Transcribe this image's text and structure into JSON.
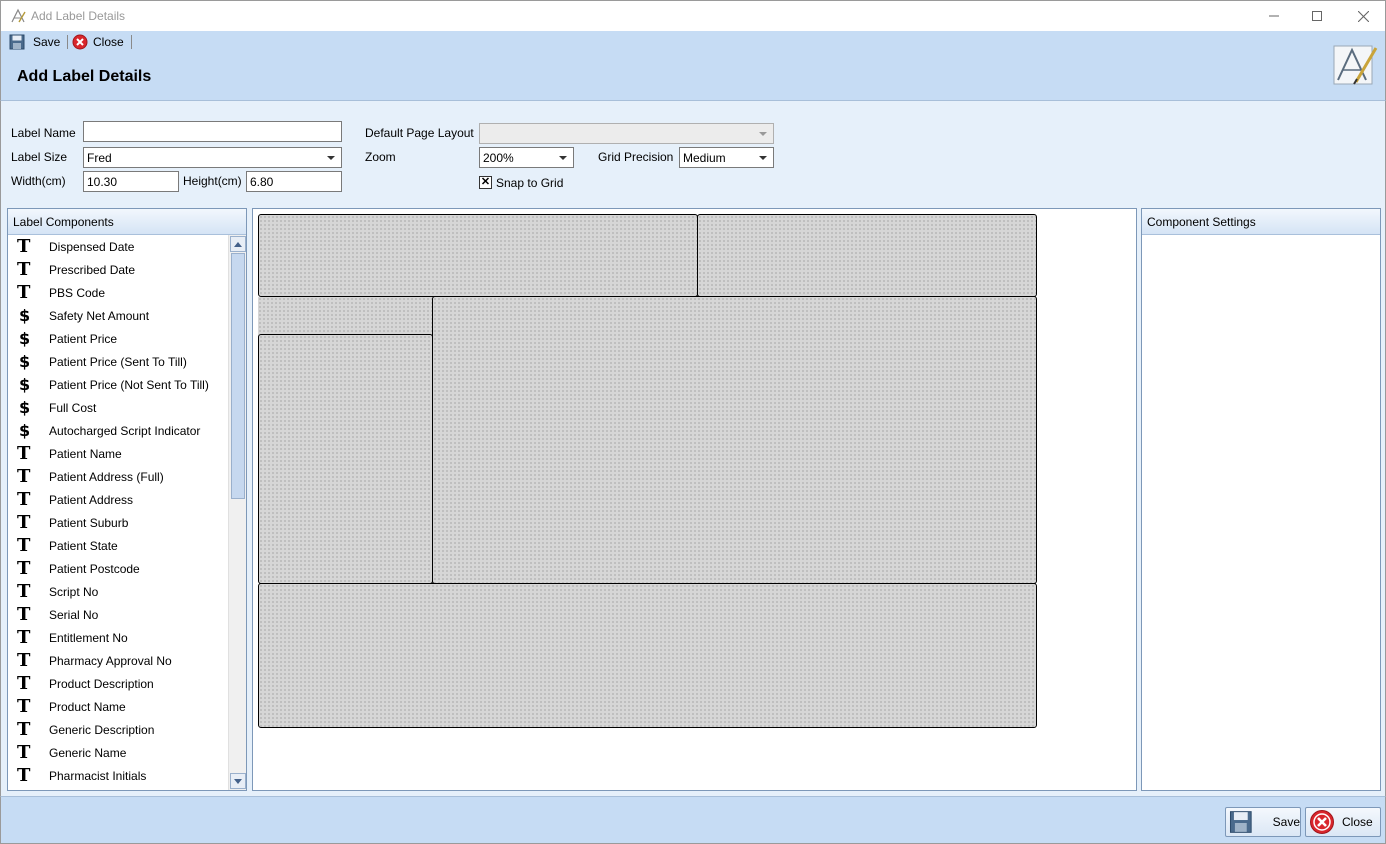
{
  "window": {
    "title": "Add Label Details"
  },
  "toolbar": {
    "save_label": "Save",
    "close_label": "Close"
  },
  "header": {
    "heading": "Add Label Details"
  },
  "form": {
    "label_name": {
      "label": "Label Name",
      "value": ""
    },
    "label_size": {
      "label": "Label Size",
      "value": "Fred"
    },
    "width": {
      "label": "Width(cm)",
      "value": "10.30"
    },
    "height": {
      "label": "Height(cm)",
      "value": "6.80"
    },
    "default_page_layout": {
      "label": "Default Page Layout",
      "value": ""
    },
    "zoom": {
      "label": "Zoom",
      "value": "200%"
    },
    "grid_precision": {
      "label": "Grid Precision",
      "value": "Medium"
    },
    "snap_to_grid": {
      "label": "Snap to Grid",
      "checked": true,
      "mark": "✕"
    }
  },
  "components_panel": {
    "title": "Label Components",
    "items": [
      {
        "icon": "text-icon",
        "glyph": "T",
        "label": "Dispensed Date"
      },
      {
        "icon": "text-icon",
        "glyph": "T",
        "label": "Prescribed Date"
      },
      {
        "icon": "text-icon",
        "glyph": "T",
        "label": "PBS Code"
      },
      {
        "icon": "dollar-icon",
        "glyph": "$",
        "label": "Safety Net Amount"
      },
      {
        "icon": "dollar-icon",
        "glyph": "$",
        "label": "Patient Price"
      },
      {
        "icon": "dollar-icon",
        "glyph": "$",
        "label": "Patient Price (Sent To Till)"
      },
      {
        "icon": "dollar-icon",
        "glyph": "$",
        "label": "Patient Price (Not Sent To Till)"
      },
      {
        "icon": "dollar-icon",
        "glyph": "$",
        "label": "Full Cost"
      },
      {
        "icon": "dollar-icon",
        "glyph": "$",
        "label": "Autocharged Script Indicator"
      },
      {
        "icon": "text-icon",
        "glyph": "T",
        "label": "Patient Name"
      },
      {
        "icon": "text-icon",
        "glyph": "T",
        "label": "Patient Address (Full)"
      },
      {
        "icon": "text-icon",
        "glyph": "T",
        "label": "Patient Address"
      },
      {
        "icon": "text-icon",
        "glyph": "T",
        "label": "Patient Suburb"
      },
      {
        "icon": "text-icon",
        "glyph": "T",
        "label": "Patient State"
      },
      {
        "icon": "text-icon",
        "glyph": "T",
        "label": "Patient Postcode"
      },
      {
        "icon": "text-icon",
        "glyph": "T",
        "label": "Script No"
      },
      {
        "icon": "text-icon",
        "glyph": "T",
        "label": "Serial No"
      },
      {
        "icon": "text-icon",
        "glyph": "T",
        "label": "Entitlement No"
      },
      {
        "icon": "text-icon",
        "glyph": "T",
        "label": "Pharmacy Approval No"
      },
      {
        "icon": "text-icon",
        "glyph": "T",
        "label": "Product Description"
      },
      {
        "icon": "text-icon",
        "glyph": "T",
        "label": "Product Name"
      },
      {
        "icon": "text-icon",
        "glyph": "T",
        "label": "Generic Description"
      },
      {
        "icon": "text-icon",
        "glyph": "T",
        "label": "Generic Name"
      },
      {
        "icon": "text-icon",
        "glyph": "T",
        "label": "Pharmacist Initials"
      }
    ]
  },
  "settings_panel": {
    "title": "Component Settings"
  },
  "footer": {
    "save_label": "Save",
    "close_label": "Close"
  },
  "colors": {
    "header_bg": "#c6dcf4",
    "form_bg": "#e6f0fa",
    "panel_border": "#7d98b8",
    "cell_bg": "#d6d6d6",
    "close_red": "#d9262c"
  }
}
